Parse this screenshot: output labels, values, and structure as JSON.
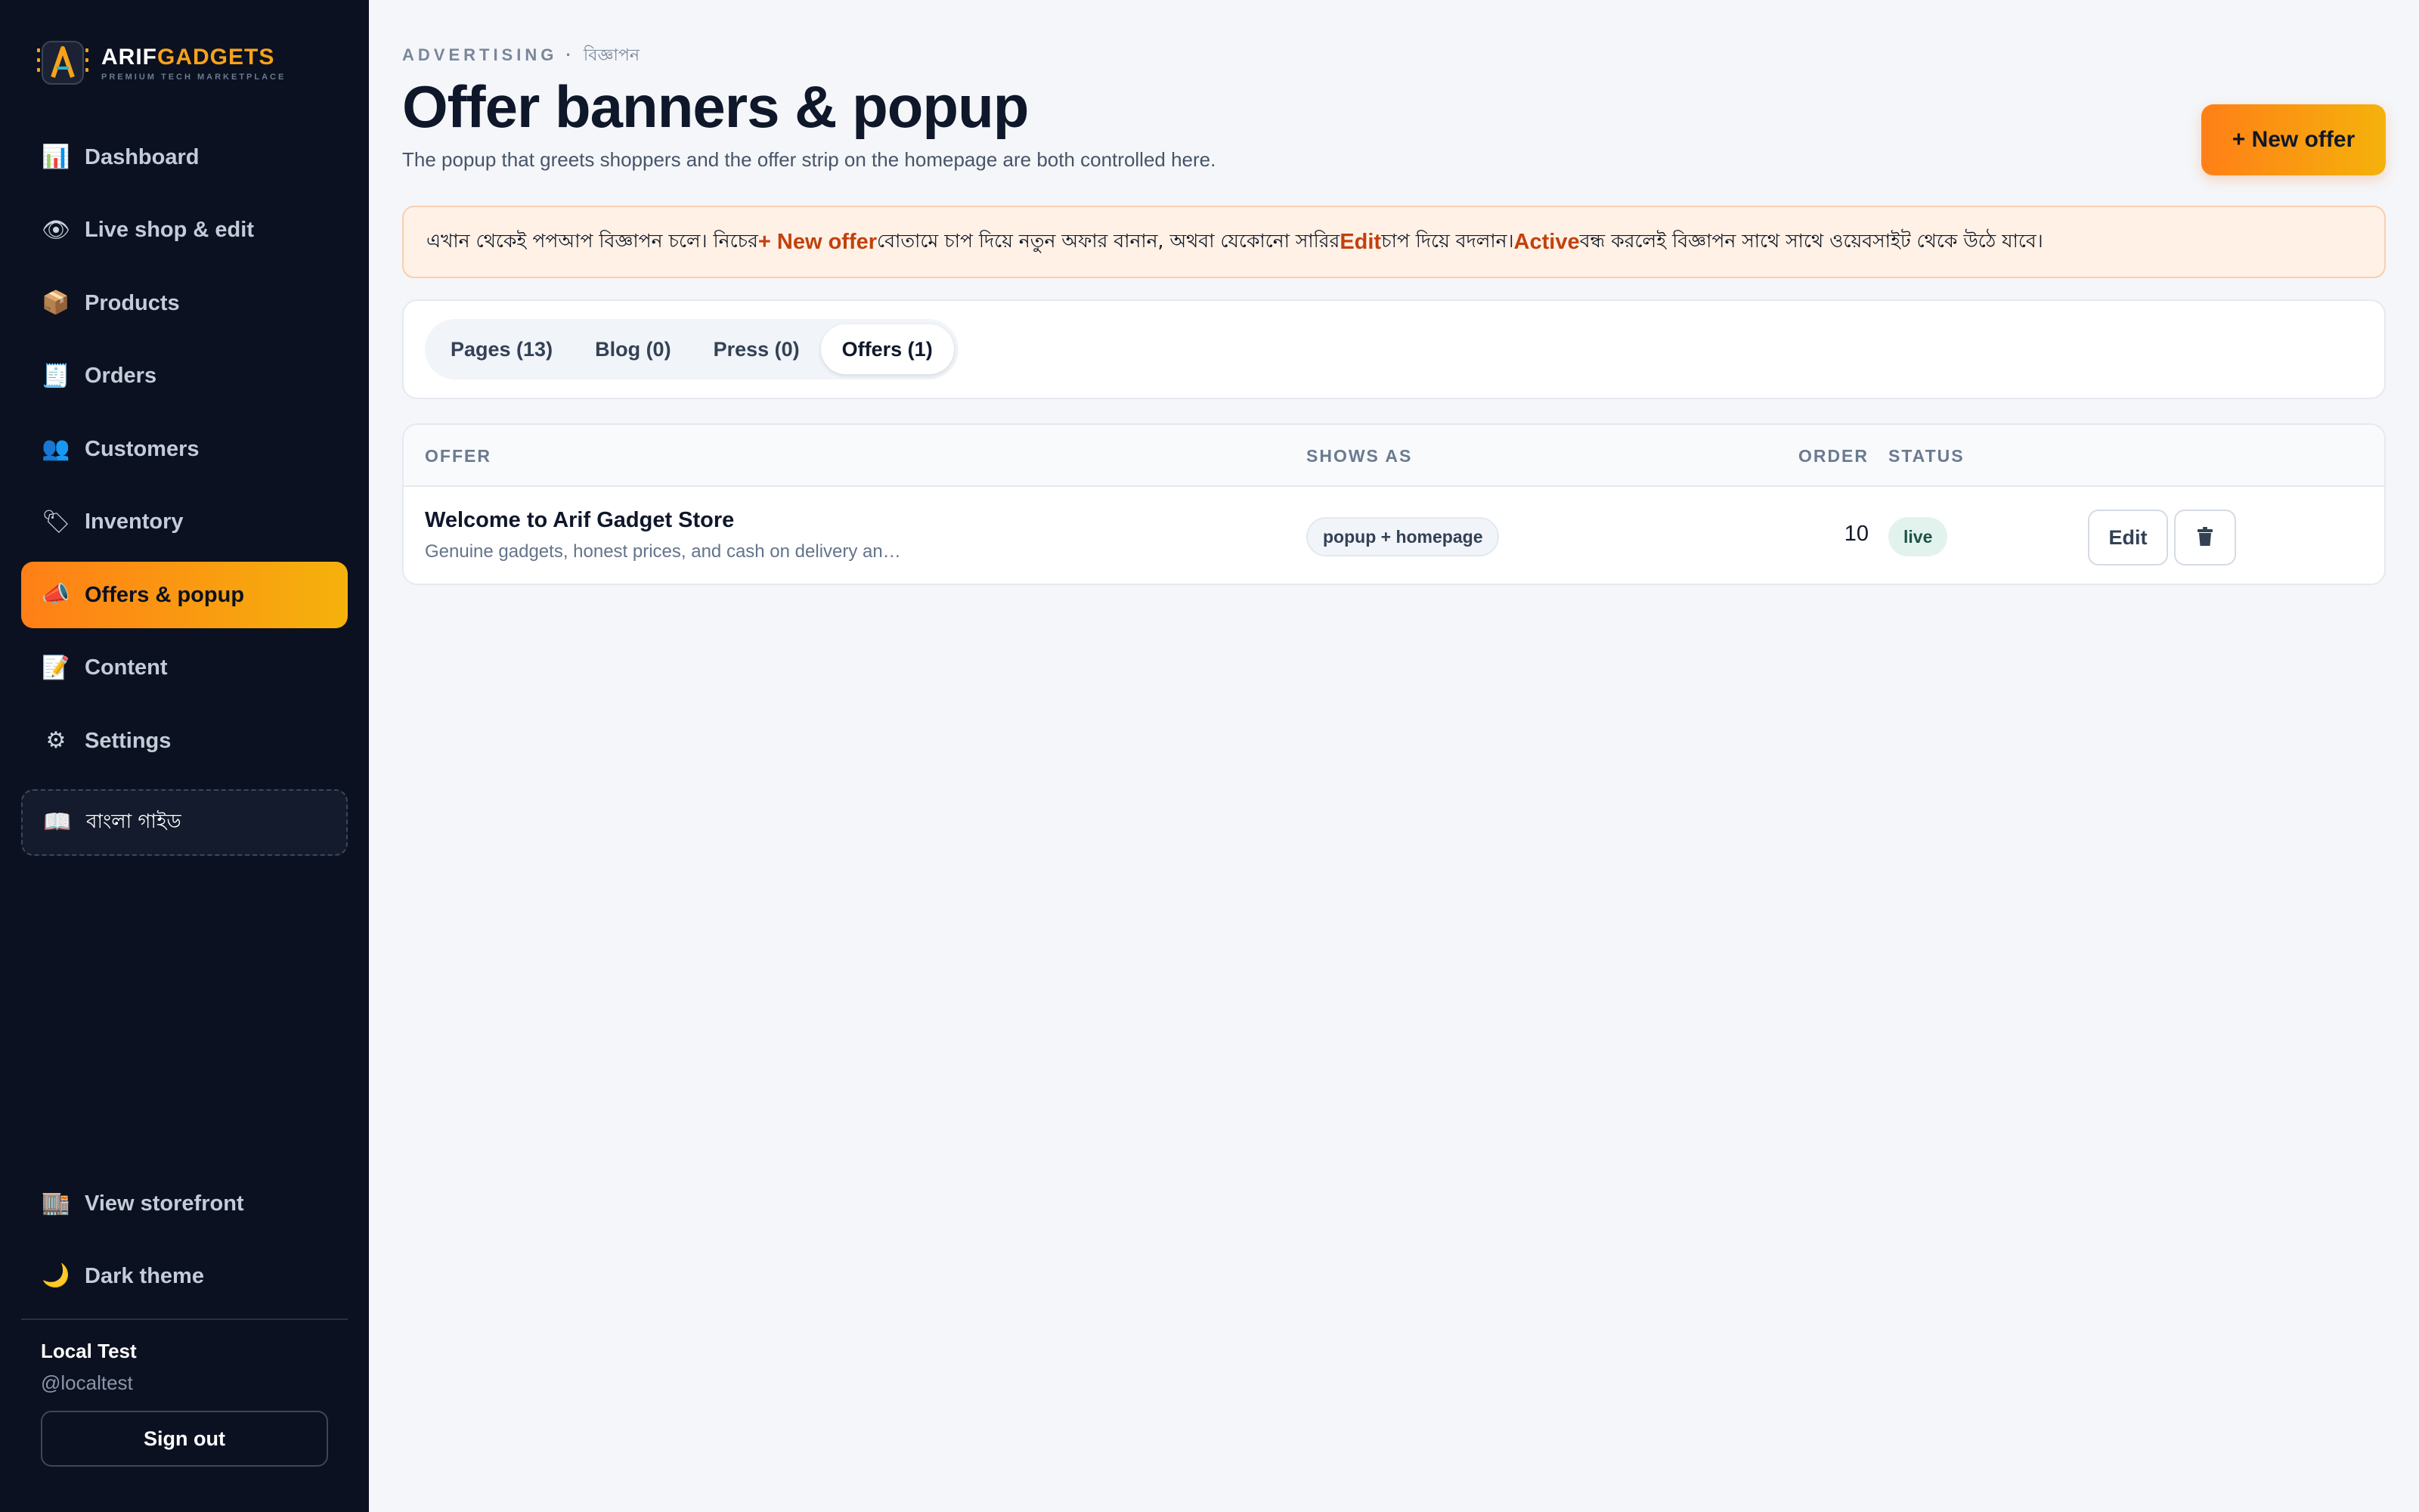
{
  "brand": {
    "name_part1": "ARIF",
    "name_part2": "GADGETS",
    "tagline": "PREMIUM TECH MARKETPLACE",
    "logo_letter": "A"
  },
  "sidebar": {
    "items": [
      {
        "label": "Dashboard",
        "icon": "chart-icon",
        "glyph": "📊"
      },
      {
        "label": "Live shop & edit",
        "icon": "eye-icon",
        "glyph": "👁"
      },
      {
        "label": "Products",
        "icon": "package-icon",
        "glyph": "📦"
      },
      {
        "label": "Orders",
        "icon": "receipt-icon",
        "glyph": "🧾"
      },
      {
        "label": "Customers",
        "icon": "people-icon",
        "glyph": "👥"
      },
      {
        "label": "Inventory",
        "icon": "tag-icon",
        "glyph": "🏷"
      },
      {
        "label": "Offers & popup",
        "icon": "megaphone-icon",
        "glyph": "📣",
        "active": true
      },
      {
        "label": "Content",
        "icon": "memo-icon",
        "glyph": "📝"
      },
      {
        "label": "Settings",
        "icon": "gear-icon",
        "glyph": "⚙"
      }
    ],
    "guide": {
      "label": "বাংলা গাইড",
      "icon": "book-icon",
      "glyph": "📖"
    },
    "bottom": [
      {
        "label": "View storefront",
        "icon": "store-icon",
        "glyph": "🏬"
      },
      {
        "label": "Dark theme",
        "icon": "moon-icon",
        "glyph": "🌙"
      }
    ],
    "user": {
      "name": "Local Test",
      "handle": "@localtest"
    },
    "signout_label": "Sign out"
  },
  "header": {
    "eyebrow": "ADVERTISING",
    "eyebrow_sep": " · ",
    "eyebrow_bn": "বিজ্ঞাপন",
    "title": "Offer banners & popup",
    "subtitle": "The popup that greets shoppers and the offer strip on the homepage are both controlled here.",
    "new_offer_label": "+ New offer"
  },
  "notice": {
    "part1": "এখান থেকেই পপআপ বিজ্ঞাপন চলে। নিচের ",
    "hl1": "+ New offer",
    "part2": " বোতামে চাপ দিয়ে নতুন অফার বানান, অথবা যেকোনো সারির ",
    "hl2": "Edit",
    "part3": " চাপ দিয়ে বদলান। ",
    "hl3": "Active",
    "part4": " বন্ধ করলেই বিজ্ঞাপন সাথে সাথে ওয়েবসাইট থেকে উঠে যাবে।"
  },
  "tabs": [
    {
      "label": "Pages (13)"
    },
    {
      "label": "Blog (0)"
    },
    {
      "label": "Press (0)"
    },
    {
      "label": "Offers (1)",
      "active": true
    }
  ],
  "table": {
    "columns": {
      "offer": "OFFER",
      "shows_as": "SHOWS AS",
      "order": "ORDER",
      "status": "STATUS"
    },
    "rows": [
      {
        "title": "Welcome to Arif Gadget Store",
        "description": "Genuine gadgets, honest prices, and cash on delivery an…",
        "shows_as": "popup + homepage",
        "order": "10",
        "status": "live",
        "edit_label": "Edit",
        "delete_icon": "trash-icon"
      }
    ]
  },
  "colors": {
    "accent_start": "#ff7f17",
    "accent_end": "#f5b20b",
    "sidebar_bg": "#0b1120",
    "notice_highlight": "#c2410c",
    "status_live_bg": "#e2f3ee"
  }
}
